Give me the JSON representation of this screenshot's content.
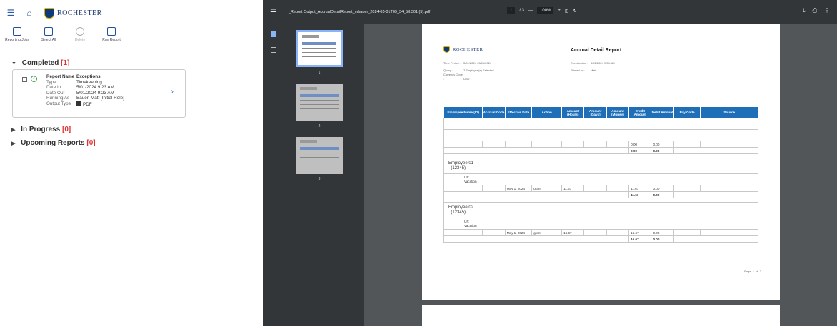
{
  "app": {
    "logo": "ROCHESTER"
  },
  "toolbar": {
    "reporting_jobs": "Reporting Jobs",
    "select_all": "Select All",
    "delete": "Delete",
    "run_report": "Run Report"
  },
  "sections": {
    "completed_label": "Completed",
    "completed_count": "[1]",
    "in_progress_label": "In Progress",
    "in_progress_count": "[0]",
    "upcoming_label": "Upcoming Reports",
    "upcoming_count": "[0]"
  },
  "job": {
    "report_name_key": "Report Name",
    "report_name": "Exceptions",
    "type_key": "Type",
    "type": "Timekeeping",
    "date_in_key": "Date In",
    "date_in": "5/01/2024 9:23 AM",
    "date_out_key": "Date Out",
    "date_out": "5/01/2024 9:23 AM",
    "running_as_key": "Running As",
    "running_as": "Bauer, Matt [Initial Role]",
    "output_type_key": "Output Type",
    "output_type": "PDF"
  },
  "viewer": {
    "filename": "_Report Output_AccrualDetailReport_mbauer_2024-05-01T09_34_58.301 (5).pdf",
    "page_current": "1",
    "page_total": "/ 3",
    "zoom": "100%",
    "thumb_numbers": [
      "1",
      "2",
      "3"
    ]
  },
  "report": {
    "title": "Accrual Detail Report",
    "time_period_key": "Time Period :",
    "time_period": "5/01/2024 - 5/01/2024",
    "query_key": "Query :",
    "query": "7 Employee(s) Selected",
    "currency_key": "Currency Code :",
    "currency": "USD",
    "executed_key": "Executed on :",
    "executed": "5/01/2024 9:34 AM",
    "printed_key": "Printed for:",
    "printed": "Matt",
    "headers": [
      "Employee Name (ID)",
      "Accrual Code",
      "Effective Date",
      "Action",
      "Amount (Hours)",
      "Amount (Days)",
      "Amount (Money)",
      "Credit Amount",
      "Debit Amount",
      "Pay Code",
      "Source"
    ],
    "blank_credit": "0.00",
    "blank_debit": "0.00",
    "blank_total_credit": "0.00",
    "blank_total_debit": "0.00",
    "emp1_name": "Employee 01",
    "emp1_id": "(12345)",
    "emp1_code": "UR",
    "emp1_code2": "Vacation",
    "emp1_date": "May 1, 2024",
    "emp1_action": "grant",
    "emp1_hours": "11.67",
    "emp1_credit": "11.67",
    "emp1_debit": "0.00",
    "emp1_total_credit": "11.67",
    "emp1_total_debit": "0.00",
    "emp2_name": "Employee 02",
    "emp2_id": "(12345)",
    "emp2_code": "UR",
    "emp2_code2": "Vacation",
    "emp2_date": "May 1, 2024",
    "emp2_action": "grant",
    "emp2_hours": "16.67",
    "emp2_credit": "16.67",
    "emp2_debit": "0.00",
    "emp2_total_credit": "16.67",
    "emp2_total_debit": "0.00",
    "footer_page": "Page",
    "footer_num": "1",
    "footer_of": "of",
    "footer_total": "3"
  }
}
